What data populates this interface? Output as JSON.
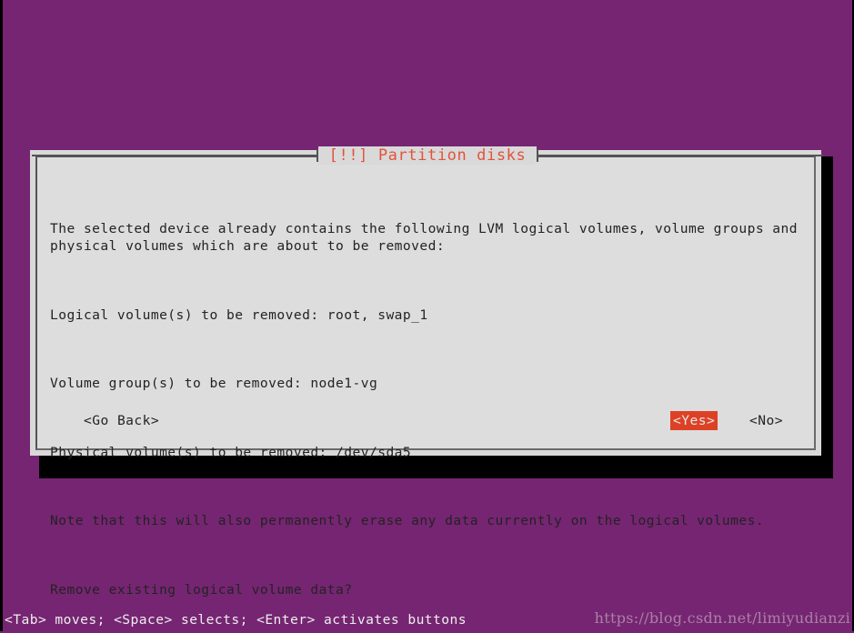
{
  "screen": {
    "background_color": "#762572"
  },
  "dialog": {
    "title": "[!!] Partition disks",
    "title_color": "#e2533b",
    "background_color": "#d9d9d9",
    "border_color": "#545454",
    "body": [
      "The selected device already contains the following LVM logical volumes, volume groups and\nphysical volumes which are about to be removed:",
      "Logical volume(s) to be removed: root, swap_1",
      "Volume group(s) to be removed: node1-vg",
      "Physical volume(s) to be removed: /dev/sda5",
      "Note that this will also permanently erase any data currently on the logical volumes.",
      "Remove existing logical volume data?"
    ],
    "buttons": {
      "go_back": "<Go Back>",
      "yes": "<Yes>",
      "no": "<No>",
      "selected": "<Yes>",
      "selected_background_color": "#dd4125",
      "selected_text_color": "#e8e8e8"
    }
  },
  "status_bar": {
    "text": "<Tab> moves; <Space> selects; <Enter> activates buttons",
    "text_color": "#eeeeee"
  },
  "watermark": {
    "text": "https://blog.csdn.net/limiyudianzi"
  }
}
